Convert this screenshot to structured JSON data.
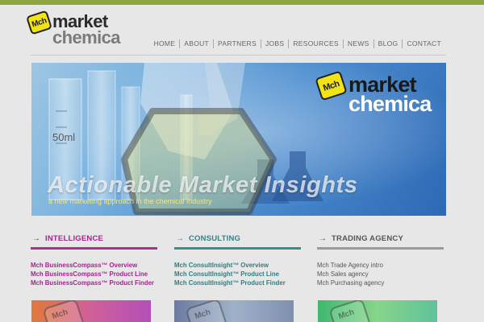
{
  "brand": {
    "mark": "Mch",
    "word1": "market",
    "word2": "chemica"
  },
  "nav": [
    "HOME",
    "ABOUT",
    "PARTNERS",
    "JOBS",
    "RESOURCES",
    "NEWS",
    "BLOG",
    "CONTACT"
  ],
  "banner": {
    "mark": "Mch",
    "word1": "market",
    "word2": "chemica",
    "flask_label": "50ml",
    "headline": "Actionable Market Insights",
    "tagline": "a new marketing approach in the chemical industry"
  },
  "columns": [
    {
      "arrow": "→",
      "title": "INTELLIGENCE",
      "links": [
        "Mch BusinessCompass™ Overview",
        "Mch BusinessCompass™ Product Line",
        "Mch BusinessCompass™ Product Finder"
      ]
    },
    {
      "arrow": "→",
      "title": "CONSULTING",
      "links": [
        "Mch ConsultInsight™ Overview",
        "Mch ConsultInsight™ Product Line",
        "Mch ConsultInsight™ Product Finder"
      ]
    },
    {
      "arrow": "→",
      "title": "TRADING AGENCY",
      "links": [
        "Mch Trade Agency intro",
        "Mch Sales agency",
        "Mch Purchasing agency"
      ]
    }
  ],
  "thumb_mark": "Mch",
  "colors": {
    "top_bar": "#8fa640",
    "intelligence": "#a3248f",
    "consulting": "#2f8585",
    "trading": "#555555",
    "logo_yellow": "#f2e315"
  }
}
